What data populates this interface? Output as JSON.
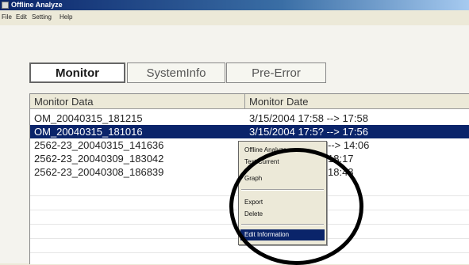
{
  "window": {
    "title": "Offline Analyze"
  },
  "menu": {
    "items": [
      "File",
      "Edit",
      "Setting",
      "Help"
    ]
  },
  "tabs": [
    {
      "label": "Monitor",
      "active": true
    },
    {
      "label": "SystemInfo",
      "active": false
    },
    {
      "label": "Pre-Error",
      "active": false
    }
  ],
  "table": {
    "columns": [
      "Monitor Data",
      "Monitor Date"
    ],
    "rows": [
      {
        "data": "OM_20040315_181215",
        "date": "3/15/2004 17:58 --> 17:58",
        "selected": false
      },
      {
        "data": "OM_20040315_181016",
        "date": "3/15/2004 17:5? --> 17:56",
        "selected": true
      },
      {
        "data": "2562-23_20040315_141636",
        "date": "--> 14:06",
        "selected": false
      },
      {
        "data": "2562-23_20040309_183042",
        "date": "18:17",
        "selected": false
      },
      {
        "data": "2562-23_20040308_186839",
        "date": "18:48",
        "selected": false
      }
    ]
  },
  "context_menu": {
    "items": [
      "Offline Analyze",
      "Test Current",
      "Graph",
      "Export",
      "Delete",
      "Edit Information"
    ],
    "highlighted": "Edit Information"
  },
  "colors": {
    "selection": "#0a246a",
    "titlebar": "#0a246a",
    "annotation_circle": "#000000"
  }
}
